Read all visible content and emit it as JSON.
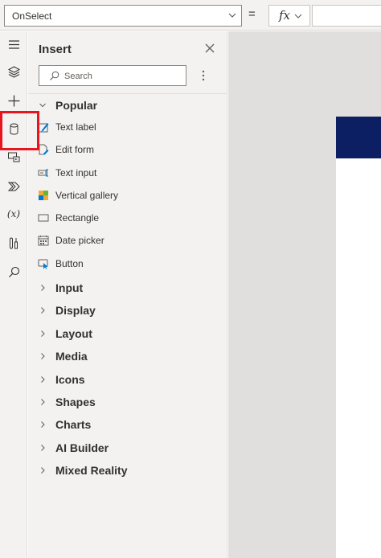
{
  "formula_bar": {
    "property": "OnSelect",
    "equals": "=",
    "fx_label": "fx",
    "formula_value": ""
  },
  "rail": {
    "variables_label": "(x)"
  },
  "insert_panel": {
    "title": "Insert",
    "search_placeholder": "Search",
    "popular": {
      "label": "Popular",
      "items": [
        {
          "label": "Text label",
          "icon": "text-label-icon"
        },
        {
          "label": "Edit form",
          "icon": "edit-form-icon"
        },
        {
          "label": "Text input",
          "icon": "text-input-icon"
        },
        {
          "label": "Vertical gallery",
          "icon": "vertical-gallery-icon"
        },
        {
          "label": "Rectangle",
          "icon": "rectangle-icon"
        },
        {
          "label": "Date picker",
          "icon": "date-picker-icon"
        },
        {
          "label": "Button",
          "icon": "button-icon"
        }
      ]
    },
    "categories": [
      {
        "label": "Input"
      },
      {
        "label": "Display"
      },
      {
        "label": "Layout"
      },
      {
        "label": "Media"
      },
      {
        "label": "Icons"
      },
      {
        "label": "Shapes"
      },
      {
        "label": "Charts"
      },
      {
        "label": "AI Builder"
      },
      {
        "label": "Mixed Reality"
      }
    ]
  },
  "colors": {
    "highlight": "#e8141e",
    "screen_header": "#0d1f63",
    "accent": "#0078d4"
  }
}
